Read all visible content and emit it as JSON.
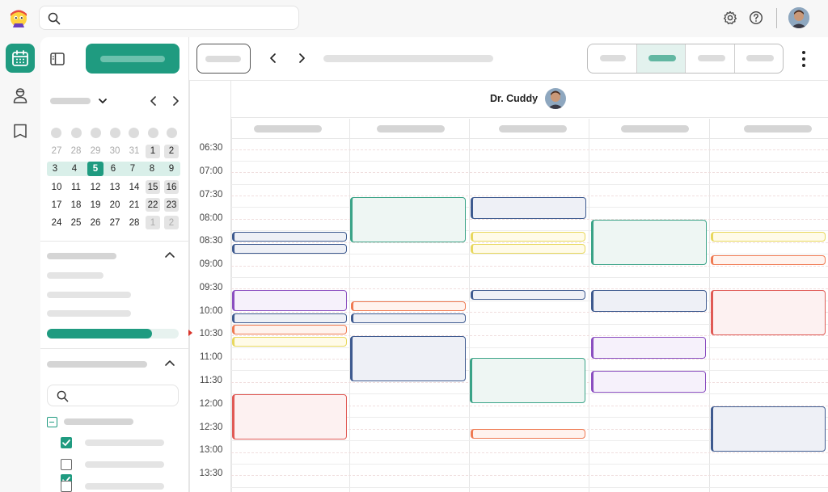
{
  "doctor": {
    "name": "Dr. Cuddy"
  },
  "mini_calendar": {
    "weeks": [
      [
        "27",
        "28",
        "29",
        "30",
        "31",
        "1",
        "2"
      ],
      [
        "3",
        "4",
        "5",
        "6",
        "7",
        "8",
        "9"
      ],
      [
        "10",
        "11",
        "12",
        "13",
        "14",
        "15",
        "16"
      ],
      [
        "17",
        "18",
        "19",
        "20",
        "21",
        "22",
        "23"
      ],
      [
        "24",
        "25",
        "26",
        "27",
        "28",
        "1",
        "2"
      ]
    ],
    "selected": "5"
  },
  "time_slots": [
    "06:30",
    "07:00",
    "07:30",
    "08:00",
    "08:30",
    "09:00",
    "09:30",
    "10:00",
    "10:30",
    "11:00",
    "11:30",
    "12:00",
    "12:30",
    "13:00",
    "13:30"
  ],
  "colors": {
    "accent": "#1f9b80",
    "green_event": "#3aa387",
    "navy_event": "#3e5a8f",
    "yellow_event": "#e8d85e",
    "orange_event": "#ef7a52",
    "purple_event": "#8b4fc0",
    "red_event": "#e05a55",
    "now_marker": "#d9342b"
  },
  "icons": {
    "logo": "mascot-logo-icon",
    "search": "search-icon",
    "settings": "gear-icon",
    "help": "question-circle-icon",
    "calendar": "calendar-icon",
    "patients": "user-icon",
    "book": "book-icon",
    "sidebar_toggle": "sidebar-toggle-icon",
    "prev": "chevron-left-icon",
    "next": "chevron-right-icon",
    "more": "more-vertical-icon"
  }
}
